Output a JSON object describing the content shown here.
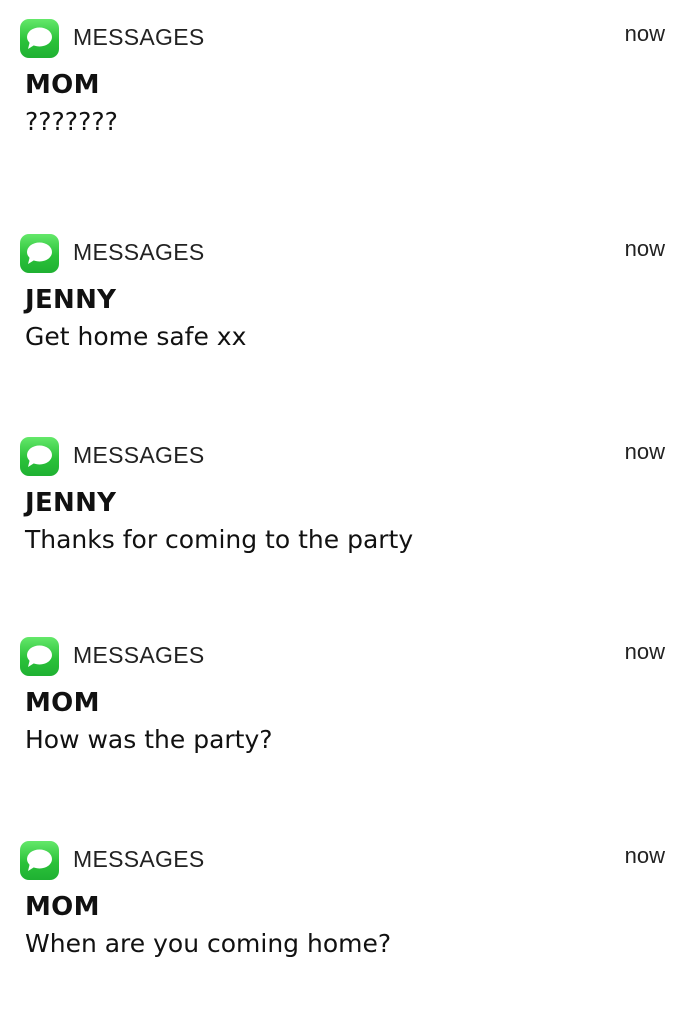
{
  "notifications": [
    {
      "app_name": "MESSAGES",
      "time": "now",
      "sender": "MOM",
      "message": "???????",
      "app_icon": "messages-bubble-icon"
    },
    {
      "app_name": "MESSAGES",
      "time": "now",
      "sender": "JENNY",
      "message": "Get home safe xx",
      "app_icon": "messages-bubble-icon"
    },
    {
      "app_name": "MESSAGES",
      "time": "now",
      "sender": "JENNY",
      "message": "Thanks for coming to the party",
      "app_icon": "messages-bubble-icon"
    },
    {
      "app_name": "MESSAGES",
      "time": "now",
      "sender": "MOM",
      "message": "How was the party?",
      "app_icon": "messages-bubble-icon"
    },
    {
      "app_name": "MESSAGES",
      "time": "now",
      "sender": "MOM",
      "message": "When are you coming home?",
      "app_icon": "messages-bubble-icon"
    }
  ],
  "colors": {
    "icon_green": "#2bc23a",
    "text": "#111111",
    "background": "#ffffff"
  }
}
